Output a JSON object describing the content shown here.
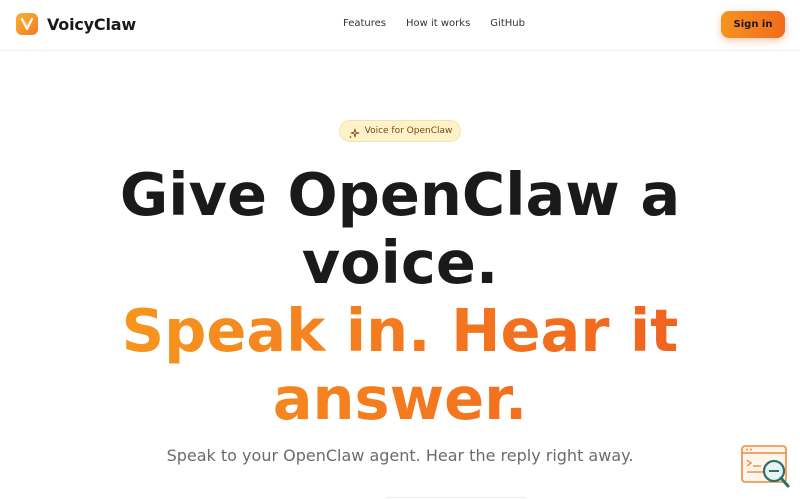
{
  "header": {
    "brand_name": "VoicyClaw",
    "logo_icon": "v-logo-icon",
    "nav": [
      {
        "label": "Features"
      },
      {
        "label": "How it works"
      },
      {
        "label": "GitHub"
      }
    ],
    "signin_label": "Sign in"
  },
  "badge": {
    "label": "Voice for OpenClaw",
    "icon": "sparkles-icon"
  },
  "hero": {
    "line1": "Give OpenClaw a",
    "line2": "voice.",
    "line3": "Speak in. Hear it",
    "line4": "answer."
  },
  "subtitle": "Speak to your OpenClaw agent. Hear the reply right away.",
  "colors": {
    "accent_start": "#f7a21e",
    "accent_end": "#ef5a1d",
    "badge_bg": "#fdf2c9",
    "text_dark": "#1a1a1a"
  }
}
